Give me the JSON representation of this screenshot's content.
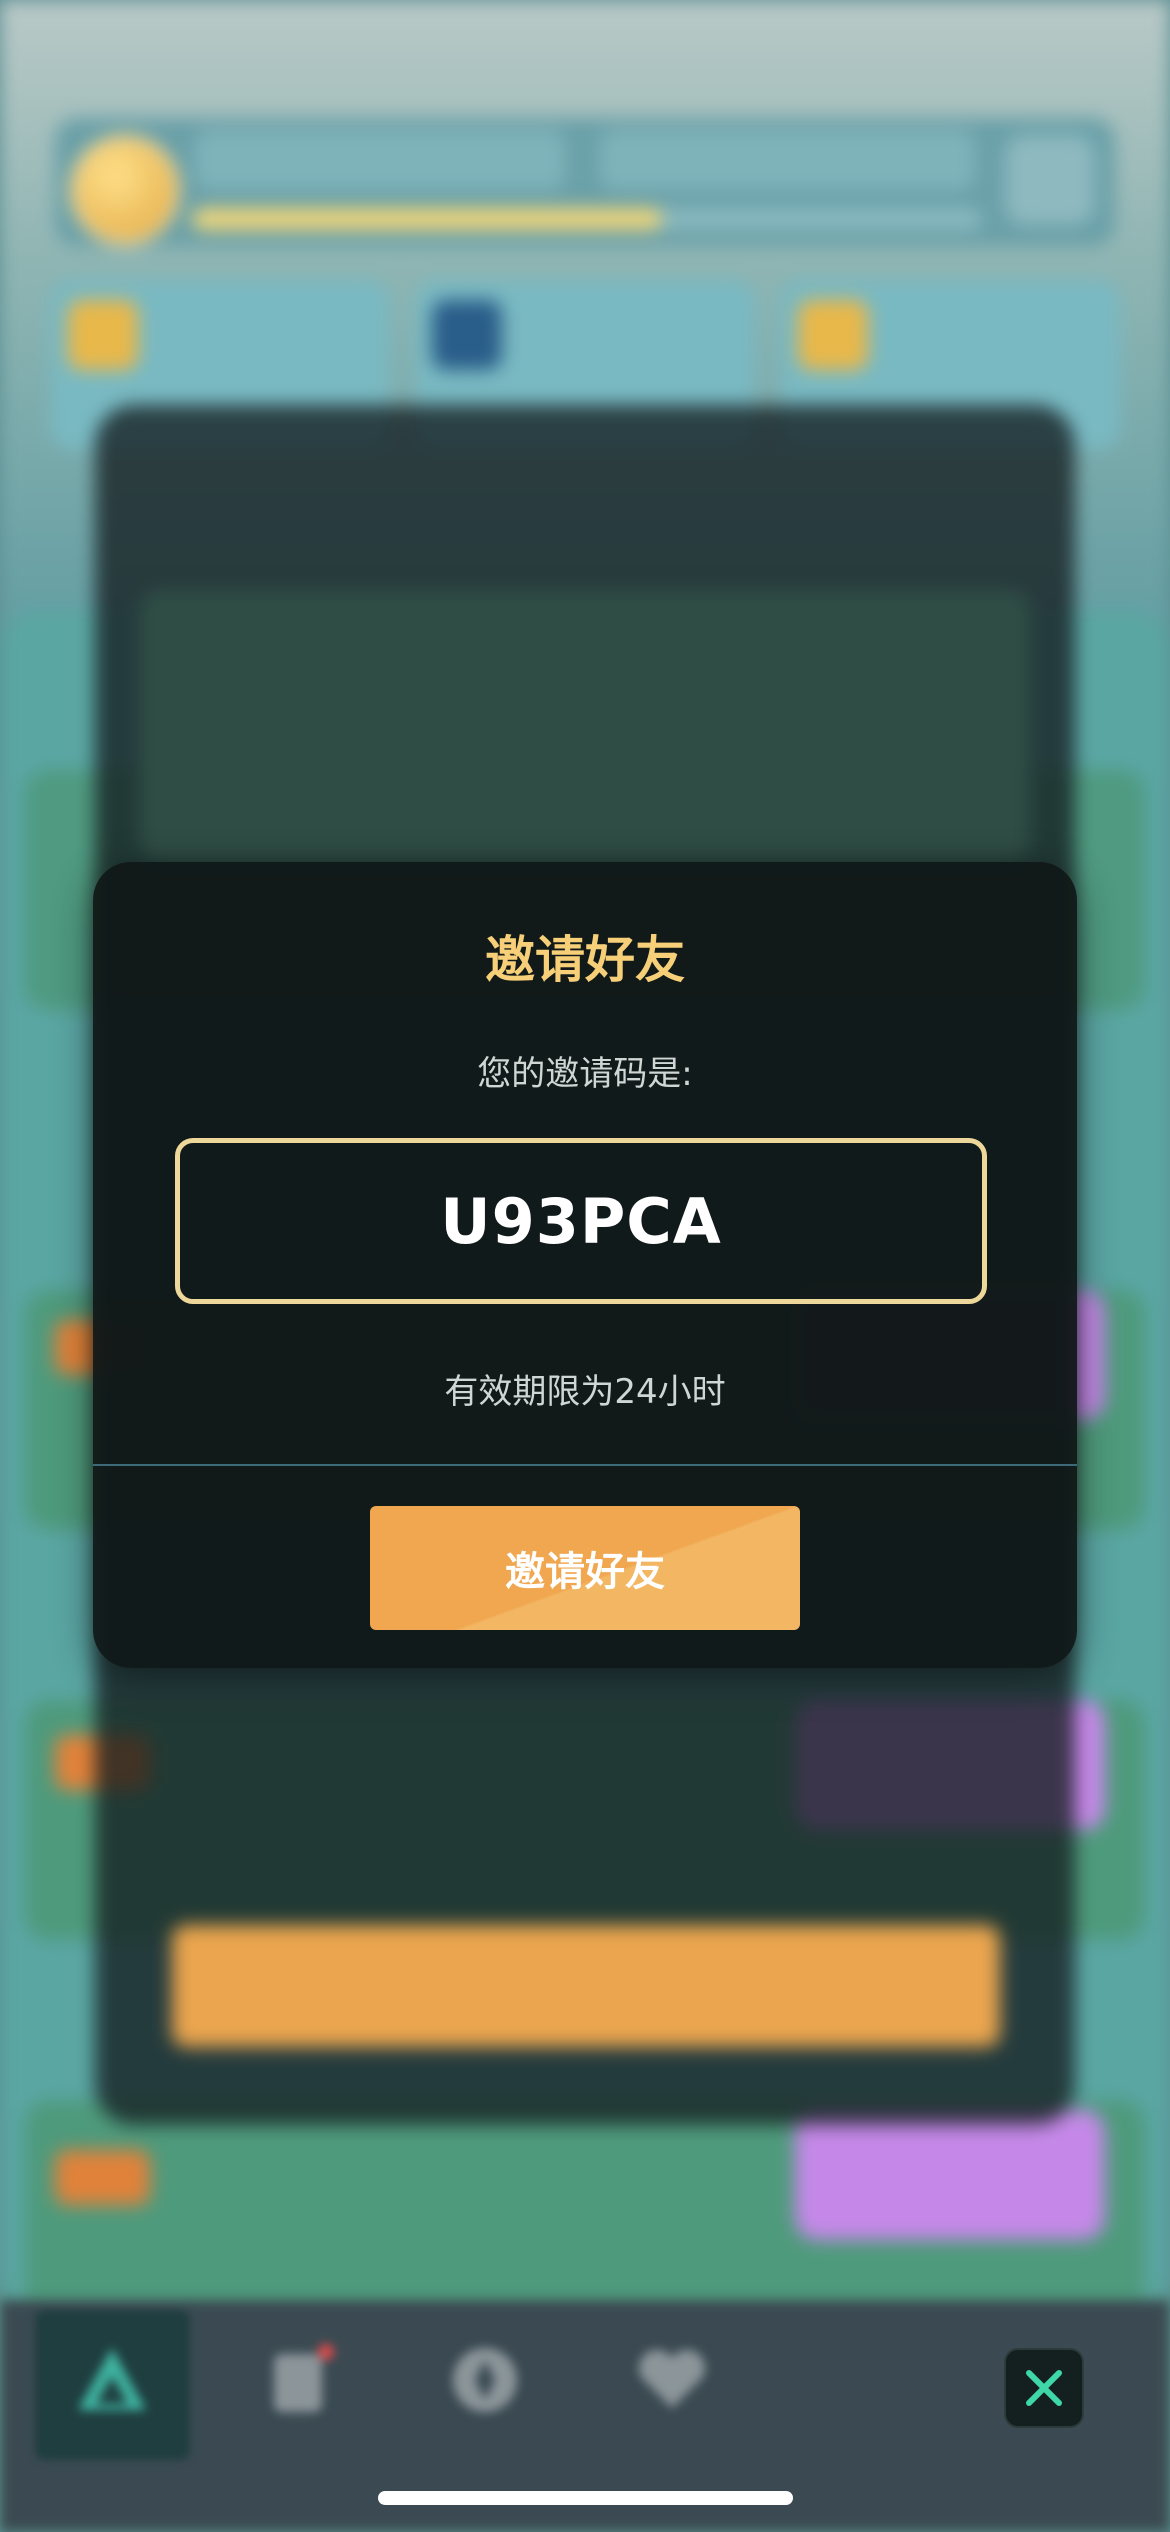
{
  "dialog": {
    "title": "邀请好友",
    "subtitle": "您的邀请码是:",
    "invite_code": "U93PCA",
    "validity": "有效期限为24小时",
    "button_label": "邀请好友"
  },
  "colors": {
    "title_gold": "#f6cf78",
    "code_border": "#eed79a",
    "button_orange": "#f0a750",
    "dialog_bg": "#101818",
    "close_icon": "#3fd6a8"
  },
  "tabbar": {
    "icons": [
      "triangle-home-icon",
      "cards-icon",
      "compass-icon",
      "heart-icon"
    ],
    "close_icon": "close-icon"
  }
}
